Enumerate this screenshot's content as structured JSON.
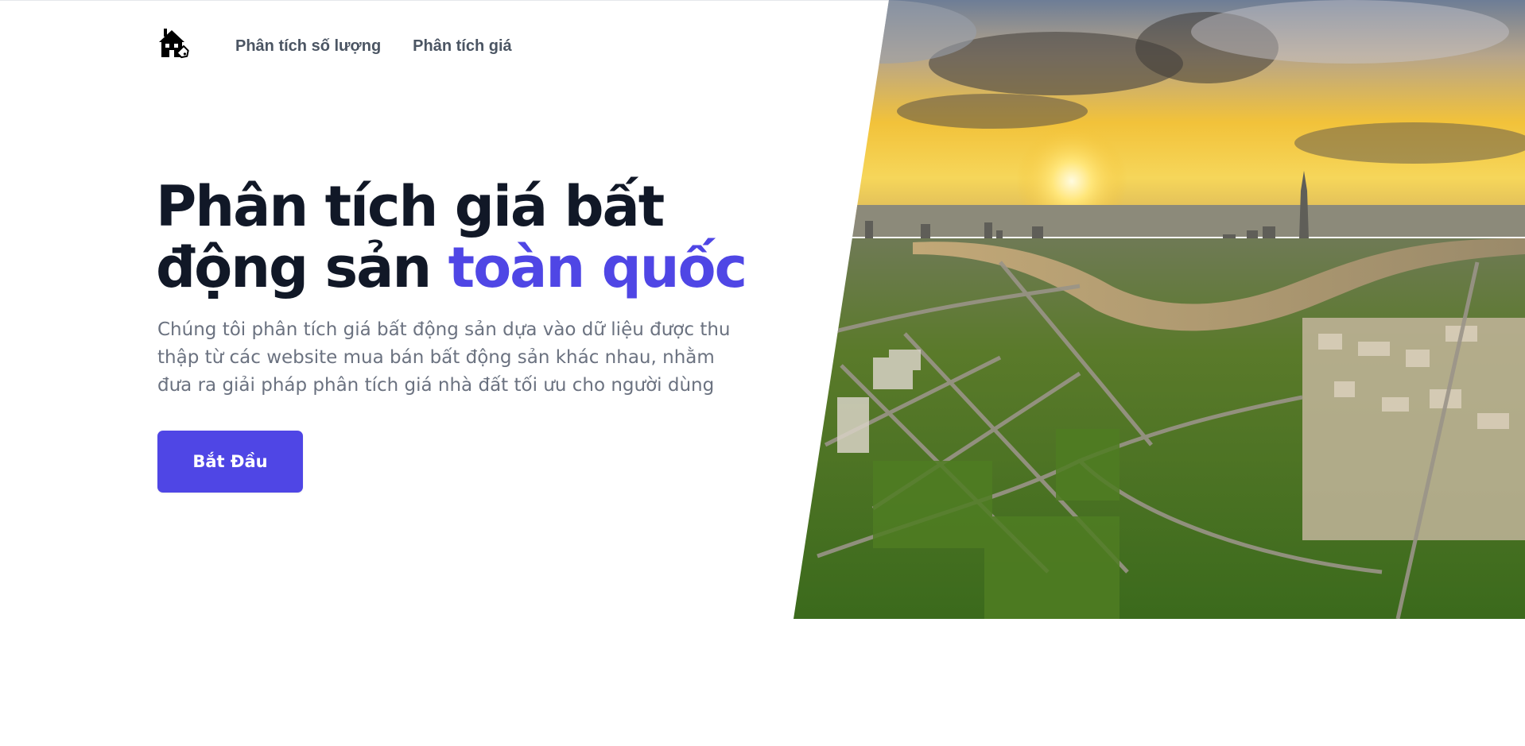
{
  "nav": {
    "logo_icon": "house-price-tag-icon",
    "links": [
      {
        "label": "Phân tích số lượng"
      },
      {
        "label": "Phân tích giá"
      }
    ]
  },
  "hero": {
    "headline_part1": "Phân tích giá bất động sản ",
    "headline_accent": "toàn quốc",
    "description": "Chúng tôi phân tích giá bất động sản dựa vào dữ liệu được thu thập từ các website mua bán bất động sản khác nhau, nhằm đưa ra giải pháp phân tích giá nhà đất tối ưu cho người dùng",
    "cta_label": "Bắt Đầu",
    "image_subject": "aerial-city-sunset-photo"
  },
  "colors": {
    "accent": "#4f46e5",
    "heading": "#111827",
    "body_text": "#6b7280",
    "nav_text": "#4b5563"
  }
}
